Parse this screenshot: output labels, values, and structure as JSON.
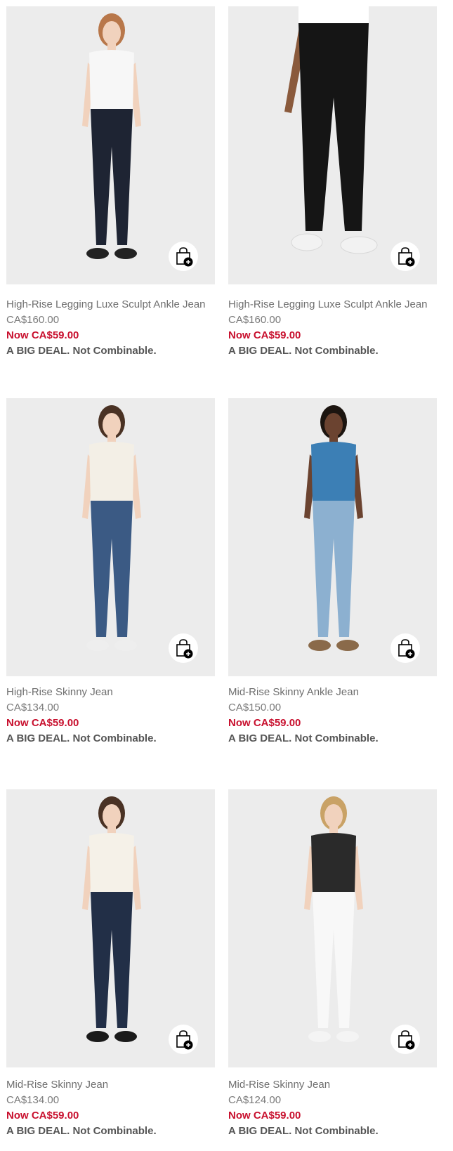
{
  "products": [
    {
      "name": "High-Rise Legging Luxe Sculpt Ankle Jean",
      "original_price": "CA$160.00",
      "sale_price": "Now CA$59.00",
      "promo": "A BIG DEAL. Not Combinable.",
      "top_color": "#f7f7f7",
      "pants_color": "#1e2433",
      "shoe_color": "#222222",
      "hair_color": "#b8774a",
      "add_to_bag_icon": "shopping-bag-plus-icon"
    },
    {
      "name": "High-Rise Legging Luxe Sculpt Ankle Jean",
      "original_price": "CA$160.00",
      "sale_price": "Now CA$59.00",
      "promo": "A BIG DEAL. Not Combinable.",
      "top_color": "#ffffff",
      "pants_color": "#151515",
      "shoe_color": "#f2f2f2",
      "hair_color": "#3a2a20",
      "add_to_bag_icon": "shopping-bag-plus-icon"
    },
    {
      "name": "High-Rise Skinny Jean",
      "original_price": "CA$134.00",
      "sale_price": "Now CA$59.00",
      "promo": "A BIG DEAL. Not Combinable.",
      "top_color": "#f3efe6",
      "pants_color": "#3b5a84",
      "shoe_color": "#eeeeee",
      "hair_color": "#4a3224",
      "add_to_bag_icon": "shopping-bag-plus-icon"
    },
    {
      "name": "Mid-Rise Skinny Ankle Jean",
      "original_price": "CA$150.00",
      "sale_price": "Now CA$59.00",
      "promo": "A BIG DEAL. Not Combinable.",
      "top_color": "#3c7fb5",
      "pants_color": "#8cb0d0",
      "shoe_color": "#8a6a4a",
      "hair_color": "#1c1510",
      "add_to_bag_icon": "shopping-bag-plus-icon"
    },
    {
      "name": "Mid-Rise Skinny Jean",
      "original_price": "CA$134.00",
      "sale_price": "Now CA$59.00",
      "promo": "A BIG DEAL. Not Combinable.",
      "top_color": "#f5f1e8",
      "pants_color": "#222f47",
      "shoe_color": "#1a1a1a",
      "hair_color": "#4a3224",
      "add_to_bag_icon": "shopping-bag-plus-icon"
    },
    {
      "name": "Mid-Rise Skinny Jean",
      "original_price": "CA$124.00",
      "sale_price": "Now CA$59.00",
      "promo": "A BIG DEAL. Not Combinable.",
      "top_color": "#2a2a2a",
      "pants_color": "#f8f8f8",
      "shoe_color": "#f4f4f4",
      "hair_color": "#c9a266",
      "add_to_bag_icon": "shopping-bag-plus-icon"
    }
  ]
}
